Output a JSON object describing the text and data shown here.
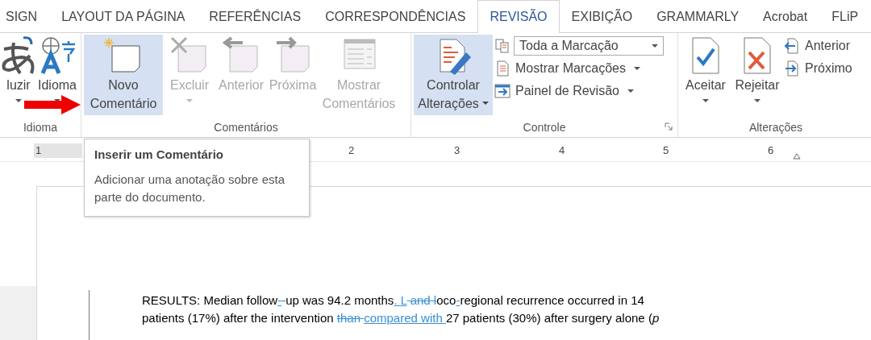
{
  "tabs": [
    {
      "label": "SIGN",
      "selected": false
    },
    {
      "label": "LAYOUT DA PÁGINA",
      "selected": false
    },
    {
      "label": "REFERÊNCIAS",
      "selected": false
    },
    {
      "label": "CORRESPONDÊNCIAS",
      "selected": false
    },
    {
      "label": "REVISÃO",
      "selected": true
    },
    {
      "label": "EXIBIÇÃO",
      "selected": false
    },
    {
      "label": "GRAMMARLY",
      "selected": false
    },
    {
      "label": "Acrobat",
      "selected": false
    },
    {
      "label": "FLiP",
      "selected": false
    }
  ],
  "groups": [
    {
      "name": "Idioma",
      "large": [
        {
          "label": "luzir",
          "disabled": false,
          "selected": false,
          "dropdown": true
        },
        {
          "label": "Idioma",
          "disabled": false,
          "selected": false,
          "dropdown": true
        }
      ],
      "launcher": false
    },
    {
      "name": "Comentários",
      "large": [
        {
          "label": "Novo Comentário",
          "disabled": false,
          "selected": true,
          "dropdown": false
        },
        {
          "label": "Excluir",
          "disabled": true,
          "selected": false,
          "dropdown": true
        },
        {
          "label": "Anterior",
          "disabled": true,
          "selected": false,
          "dropdown": false
        },
        {
          "label": "Próxima",
          "disabled": true,
          "selected": false,
          "dropdown": false
        },
        {
          "label": "Mostrar Comentários",
          "disabled": true,
          "selected": false,
          "dropdown": false
        }
      ],
      "launcher": false
    },
    {
      "name": "Controle",
      "large": [
        {
          "label": "Controlar Alterações",
          "disabled": false,
          "selected": true,
          "dropdown": true
        }
      ],
      "small": [
        {
          "kind": "select",
          "label": "Toda a Marcação"
        },
        {
          "kind": "menu",
          "label": "Mostrar Marcações"
        },
        {
          "kind": "menu",
          "label": "Painel de Revisão"
        }
      ],
      "launcher": true
    },
    {
      "name": "Alterações",
      "large": [
        {
          "label": "Aceitar",
          "disabled": false,
          "selected": false,
          "dropdown": true
        },
        {
          "label": "Rejeitar",
          "disabled": false,
          "selected": false,
          "dropdown": true
        }
      ],
      "small": [
        {
          "kind": "plain",
          "label": "Anterior"
        },
        {
          "kind": "plain",
          "label": "Próximo"
        }
      ],
      "launcher": false
    }
  ],
  "ruler": {
    "numbers": [
      "1",
      "2",
      "3",
      "4",
      "5",
      "6"
    ]
  },
  "tooltip": {
    "title": "Inserir um Comentário",
    "text": "Adicionar uma anotação sobre esta parte do documento."
  },
  "document": {
    "lines": [
      [
        {
          "kind": "normal",
          "text": "RESULTS: Median follow"
        },
        {
          "kind": "inserted",
          "text": "-"
        },
        {
          "kind": "deleted",
          "text": "-"
        },
        {
          "kind": "normal",
          "text": "up was 94.2 months"
        },
        {
          "kind": "inserted",
          "text": ". L"
        },
        {
          "kind": "deleted",
          "text": " and l"
        },
        {
          "kind": "normal",
          "text": "oco"
        },
        {
          "kind": "inserted",
          "text": "-"
        },
        {
          "kind": "normal",
          "text": "regional recurrence occurred in 14"
        }
      ],
      [
        {
          "kind": "normal",
          "text": "patients (17%) after the intervention "
        },
        {
          "kind": "deleted",
          "text": "than "
        },
        {
          "kind": "inserted",
          "text": "compared with "
        },
        {
          "kind": "normal",
          "text": "27 patients (30%) after surgery alone (*p*"
        }
      ]
    ]
  }
}
